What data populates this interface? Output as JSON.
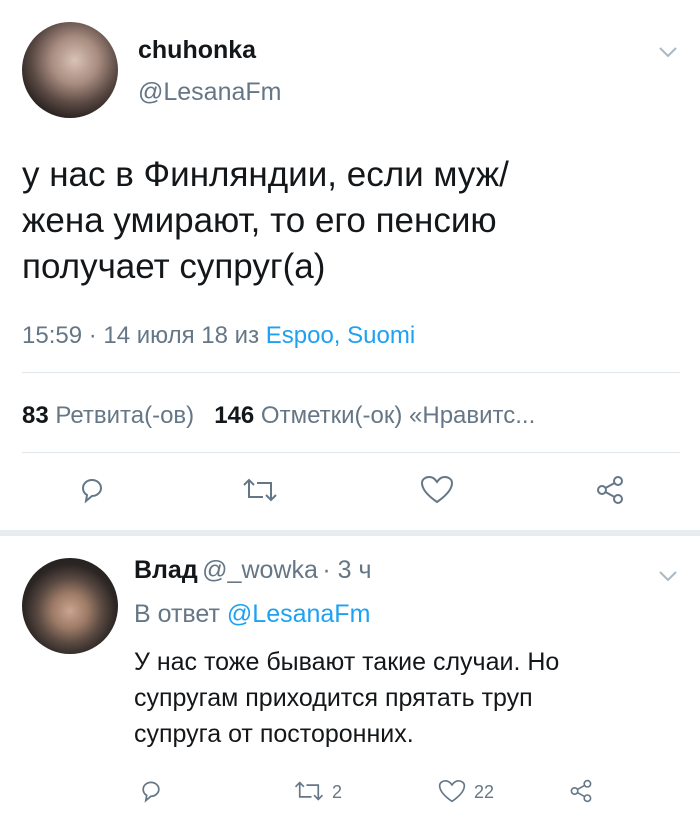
{
  "tweet": {
    "display_name": "chuhonka",
    "handle": "@LesanaFm",
    "text_lines": [
      "у нас в Финляндии, если муж/",
      "жена умирают, то его пенсию",
      "получает супруг(а)"
    ],
    "time": "15:59 · 14 июля 18 из ",
    "location": "Espoo, Suomi",
    "retweets_count": "83",
    "retweets_label": "Ретвита(-ов)",
    "likes_count": "146",
    "likes_label": "Отметки(-ок) «Нравитс..."
  },
  "reply": {
    "display_name": "Влад",
    "handle": "@_wowka",
    "time": "· 3 ч",
    "in_reply_prefix": "В ответ",
    "in_reply_handle": "@LesanaFm",
    "text_lines": [
      "У нас тоже бывают такие случаи. Но",
      "супругам приходится прятать труп",
      "супруга от посторонних."
    ],
    "retweet_count": "2",
    "like_count": "22"
  },
  "icons": [
    "chevron-down-icon",
    "reply-icon",
    "retweet-icon",
    "like-icon",
    "share-icon"
  ],
  "colors": {
    "link": "#1da1f2",
    "muted": "#657786",
    "text": "#14171a",
    "divider": "#e1e8ed"
  }
}
